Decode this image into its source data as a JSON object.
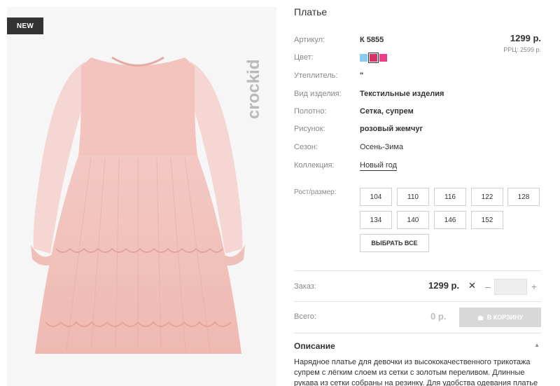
{
  "badge": {
    "new_label": "NEW"
  },
  "brand": {
    "logo_text": "crockid"
  },
  "product": {
    "title": "Платье",
    "price": "1299 р.",
    "rrc_price": "РРЦ: 2599 р."
  },
  "specs": [
    {
      "label": "Артикул:",
      "value": "К 5855"
    },
    {
      "label": "Цвет:",
      "value": ""
    },
    {
      "label": "Утеплитель:",
      "value": "\""
    },
    {
      "label": "Вид изделия:",
      "value": "Текстильные изделия"
    },
    {
      "label": "Полотно:",
      "value": "Сетка, супрем"
    },
    {
      "label": "Рисунок:",
      "value": "розовый жемчуг"
    },
    {
      "label": "Сезон:",
      "value": "Осень-Зима"
    },
    {
      "label": "Коллекция:",
      "value": "Новый год"
    }
  ],
  "colors": [
    {
      "name": "light-blue",
      "hex": "#8ccbf0"
    },
    {
      "name": "crimson",
      "hex": "#d6336b",
      "selected": true
    },
    {
      "name": "pink",
      "hex": "#ea3f86"
    }
  ],
  "sizes": {
    "label": "Рост/размер:",
    "options": [
      "104",
      "110",
      "116",
      "122",
      "128",
      "134",
      "140",
      "146",
      "152"
    ],
    "select_all": "ВЫБРАТЬ ВСЕ"
  },
  "order": {
    "label": "Заказ:",
    "price": "1299 р.",
    "times": "✕",
    "minus": "–",
    "plus": "+",
    "quantity": ""
  },
  "total": {
    "label": "Всего:",
    "value": "0 р.",
    "cart_button": "В КОРЗИНУ"
  },
  "description": {
    "title": "Описание",
    "toggle": "▲",
    "text": "Нарядное платье для девочки из высококачественного трикотажа супрем с лёгким слоем из сетки с золотым переливом. Длинные рукава из сетки собраны на резинку. Для удобства одевания платье"
  }
}
